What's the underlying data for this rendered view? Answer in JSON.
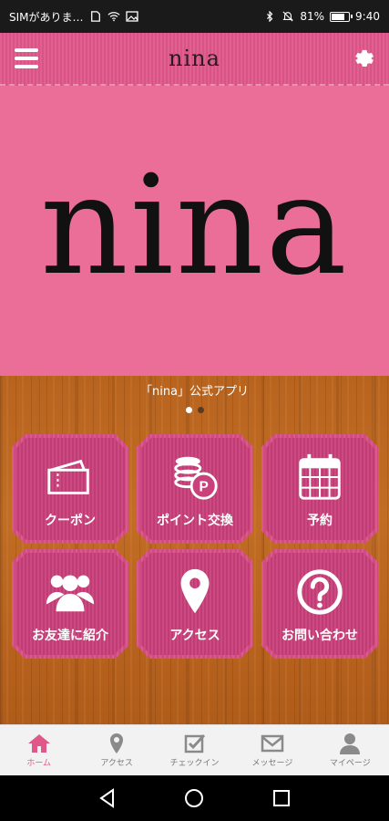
{
  "status_bar": {
    "carrier": "SIMがありま…",
    "battery": "81%",
    "battery_level": 0.81,
    "time": "9:40"
  },
  "header": {
    "title": "nina",
    "menu_icon": "hamburger-menu-icon",
    "settings_icon": "gear-icon"
  },
  "hero": {
    "logo_text": "nina"
  },
  "carousel": {
    "caption": "「nina」公式アプリ",
    "page_count": 2,
    "active_index": 0
  },
  "tiles": [
    {
      "label": "クーポン",
      "icon": "ticket-icon"
    },
    {
      "label": "ポイント交換",
      "icon": "coins-point-icon"
    },
    {
      "label": "予約",
      "icon": "calendar-icon"
    },
    {
      "label": "お友達に紹介",
      "icon": "friends-icon"
    },
    {
      "label": "アクセス",
      "icon": "map-pin-icon"
    },
    {
      "label": "お問い合わせ",
      "icon": "question-icon"
    }
  ],
  "tabbar": {
    "tabs": [
      {
        "label": "ホーム",
        "icon": "home-icon",
        "active": true
      },
      {
        "label": "アクセス",
        "icon": "map-pin-icon",
        "active": false
      },
      {
        "label": "チェックイン",
        "icon": "checkbox-icon",
        "active": false
      },
      {
        "label": "メッセージ",
        "icon": "mail-icon",
        "active": false
      },
      {
        "label": "マイページ",
        "icon": "person-icon",
        "active": false
      }
    ]
  },
  "colors": {
    "brand_pink": "#e0578a",
    "hero_pink": "#ea6e98",
    "tile_pink": "#c9407a",
    "wood": "#b8641f",
    "active_tab": "#e0578a"
  }
}
